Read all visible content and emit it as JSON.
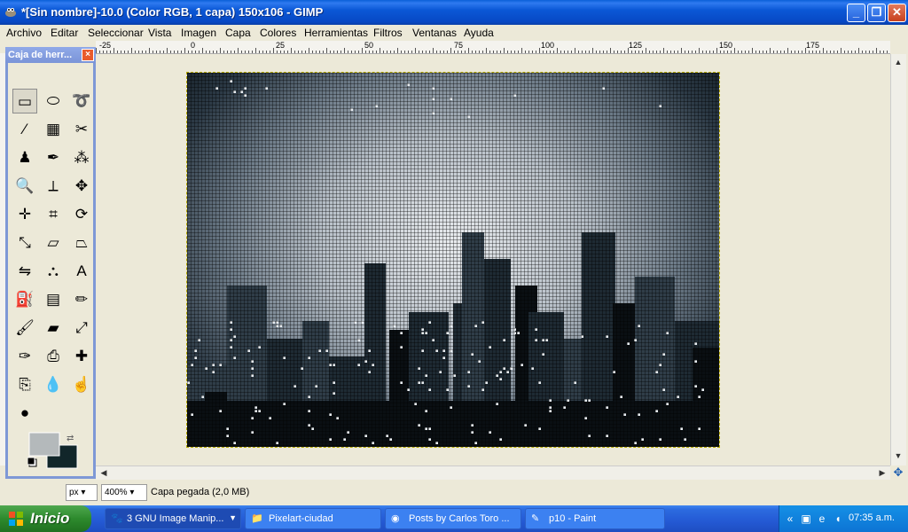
{
  "window": {
    "title": "*[Sin nombre]-10.0 (Color RGB, 1 capa) 150x106 - GIMP",
    "app_icon": "gimp-wilber-icon",
    "controls": [
      "minimize",
      "maximize",
      "close"
    ]
  },
  "menubar": {
    "items": [
      "Archivo",
      "Editar",
      "Seleccionar",
      "Vista",
      "Imagen",
      "Capa",
      "Colores",
      "Herramientas",
      "Filtros",
      "Ventanas",
      "Ayuda"
    ]
  },
  "ruler": {
    "top_labels": [
      "-25",
      "0",
      "25",
      "50",
      "75",
      "100",
      "125",
      "150",
      "175"
    ]
  },
  "toolbox": {
    "title": "Caja de herr...",
    "tools": [
      "rect-select-icon",
      "ellipse-select-icon",
      "free-select-icon",
      "fuzzy-select-icon",
      "select-by-color-icon",
      "scissors-select-icon",
      "foreground-select-icon",
      "paths-icon",
      "color-picker-icon",
      "zoom-icon",
      "measure-icon",
      "move-icon",
      "align-icon",
      "crop-icon",
      "rotate-icon",
      "scale-icon",
      "shear-icon",
      "perspective-icon",
      "flip-icon",
      "cage-icon",
      "text-icon",
      "bucket-fill-icon",
      "blend-icon",
      "pencil-icon",
      "paintbrush-icon",
      "eraser-icon",
      "airbrush-icon",
      "ink-icon",
      "clone-icon",
      "heal-icon",
      "perspective-clone-icon",
      "blur-icon",
      "smudge-icon",
      "dodge-burn-icon"
    ],
    "selected_tool": "rect-select-icon",
    "fg_color": "#b4b9bb",
    "bg_color": "#11262a"
  },
  "statusbar": {
    "unit": "px",
    "zoom": "400%",
    "message": "Capa pegada (2,0 MB)"
  },
  "taskbar": {
    "start_label": "Inicio",
    "tasks": [
      {
        "label": "3 GNU Image Manip...",
        "icon": "gimp-icon",
        "active": true
      },
      {
        "label": "Pixelart-ciudad",
        "icon": "folder-icon",
        "active": false
      },
      {
        "label": "Posts by Carlos Toro ...",
        "icon": "firefox-icon",
        "active": false
      },
      {
        "label": "p10 - Paint",
        "icon": "paint-icon",
        "active": false
      }
    ],
    "clock": "07:35 a.m."
  }
}
